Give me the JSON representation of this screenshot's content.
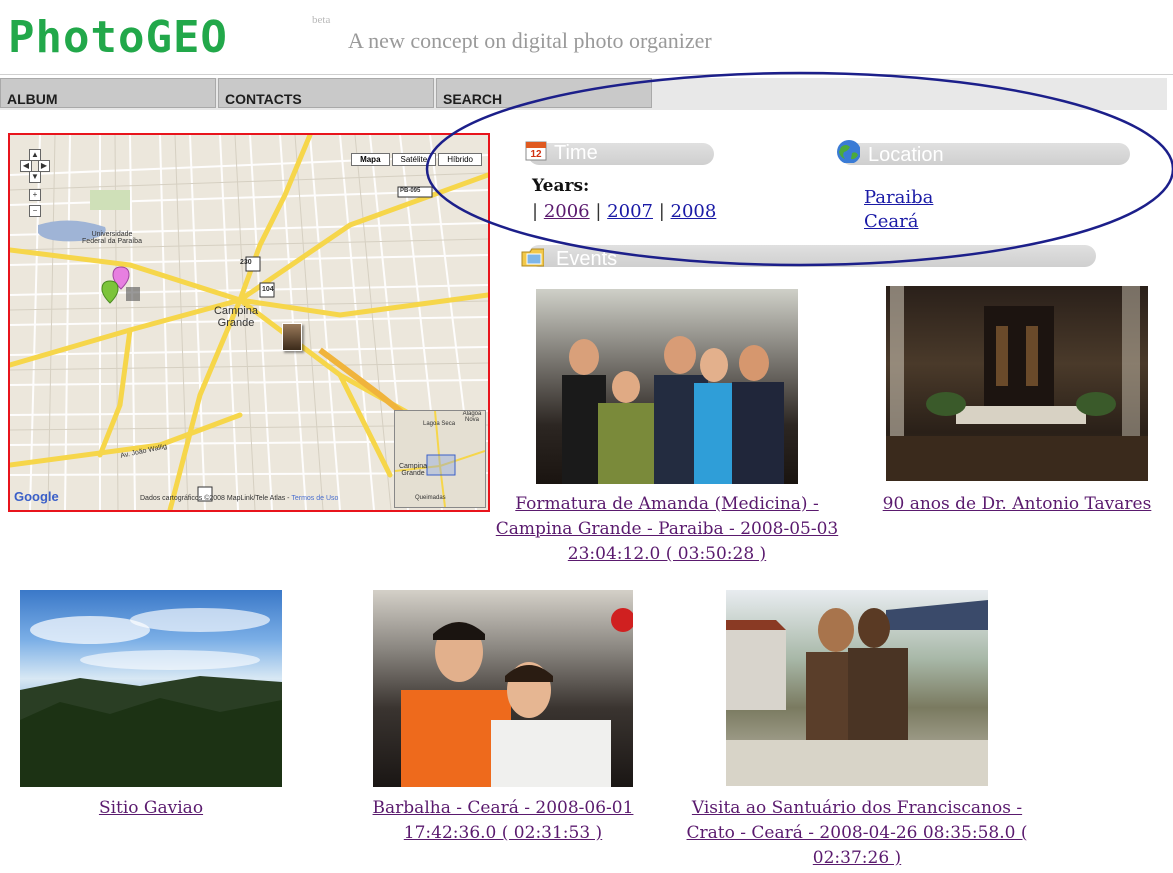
{
  "header": {
    "logo_photo": "Photo",
    "logo_geo": "GEO",
    "beta": "beta",
    "tagline": "A new concept on digital photo organizer"
  },
  "nav": {
    "tabs": [
      {
        "label": "ALBUM"
      },
      {
        "label": "CONTACTS"
      },
      {
        "label": "SEARCH"
      }
    ]
  },
  "map": {
    "map_types": [
      "Mapa",
      "Satélite",
      "Híbrido"
    ],
    "active_type": "Mapa",
    "city_label": "Campina Grande",
    "university_label": "Universidade Federal da Paraíba",
    "provider": "Google",
    "credit": "Dados cartográficos ©2008 MapLink/Tele Atlas -",
    "terms": "Termos de Uso",
    "minimap_labels": [
      "Lagoa Seca",
      "Alagoa Nova",
      "Campina Grande",
      "Queimadas"
    ],
    "road_labels": [
      "PB-095",
      "230",
      "104"
    ],
    "street_labels": [
      "Av. João Wallig",
      "Av. Floriano Peixoto"
    ]
  },
  "filters": {
    "time": {
      "title": "Time",
      "icon": "calendar-icon",
      "years_label": "Years:",
      "years": [
        "2006",
        "2007",
        "2008"
      ]
    },
    "location": {
      "title": "Location",
      "icon": "globe-icon",
      "items": [
        "Paraiba",
        "Ceará"
      ]
    },
    "events": {
      "title": "Events",
      "icon": "folder-icon"
    }
  },
  "photos": [
    {
      "caption": "Formatura de Amanda (Medicina) - Campina Grande - Paraiba - 2008-05-03 23:04:12.0 ( 03:50:28 )"
    },
    {
      "caption": "90 anos de Dr. Antonio Tavares"
    },
    {
      "caption": "Sitio Gaviao"
    },
    {
      "caption": "Barbalha - Ceará - 2008-06-01 17:42:36.0 ( 02:31:53 )"
    },
    {
      "caption": "Visita ao Santuário dos Franciscanos - Crato - Ceará - 2008-04-26 08:35:58.0 ( 02:37:26 )"
    }
  ],
  "colors": {
    "logo_green": "#22a84a",
    "map_border": "#e8141c",
    "annotation_ellipse": "#1c1f8a",
    "link": "#1a1aa6",
    "visited_link": "#5a1a6e"
  }
}
